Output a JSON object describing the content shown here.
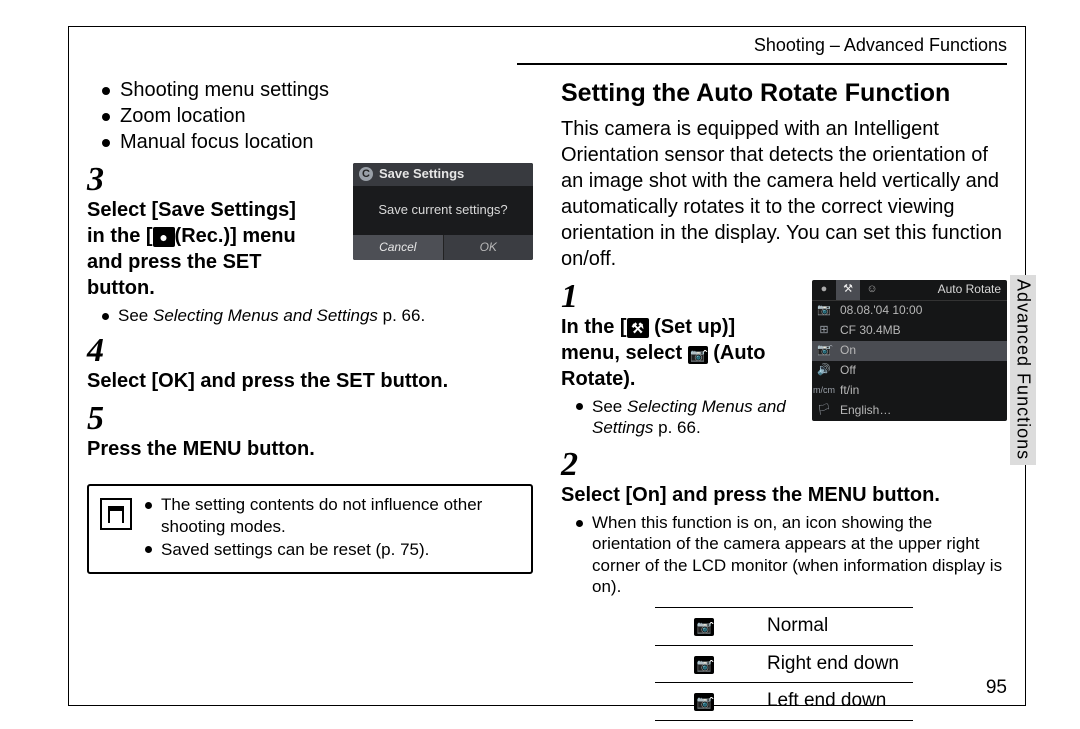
{
  "header": "Shooting – Advanced Functions",
  "left": {
    "bullets": [
      "Shooting menu settings",
      "Zoom location",
      "Manual focus location"
    ],
    "step3_a": "Select [Save Settings] in the [",
    "step3_b": "(Rec.)] menu and press the SET button.",
    "rec_icon": "●",
    "step3_sub_prefix": "See ",
    "step3_sub_em": "Selecting Menus and Settings",
    "step3_sub_suffix": " p. 66.",
    "step4": "Select [OK] and press the SET button.",
    "step5": "Press the MENU button.",
    "note1": "The setting contents do not influence other shooting modes.",
    "note2": "Saved settings can be reset (p. 75).",
    "lcd": {
      "title": "Save Settings",
      "prompt": "Save current settings?",
      "cancel": "Cancel",
      "ok": "OK"
    }
  },
  "right": {
    "heading": "Setting the Auto Rotate Function",
    "intro": "This camera is equipped with an Intelligent Orientation sensor that detects the orientation of an image shot with the camera held vertically and automatically rotates it to the correct viewing orientation in the display. You can set this function on/off.",
    "step1_a": "In the [",
    "step1_b": " (Set up)] menu, select ",
    "step1_c": " (Auto Rotate).",
    "tools_icon": "⚒",
    "cam_icon": "📷̂",
    "step1_sub_prefix": "See ",
    "step1_sub_em": "Selecting Menus and Settings",
    "step1_sub_suffix": " p. 66.",
    "step2": "Select [On] and press the MENU button.",
    "step2_sub": "When this function is on, an icon showing the orientation of the camera appears at the upper right corner of the LCD monitor (when information display is on).",
    "table": [
      {
        "icon": "📷̂",
        "label": "Normal"
      },
      {
        "icon": "📷̂",
        "label": "Right end down"
      },
      {
        "icon": "📷̂",
        "label": "Left end down"
      }
    ],
    "lcd": {
      "title": "Auto Rotate",
      "rows": [
        {
          "ic": "📷",
          "tx": "08.08.'04 10:00"
        },
        {
          "ic": "⊞",
          "tx": "CF 30.4MB"
        },
        {
          "ic": "📷̂",
          "tx": "On",
          "hl": true
        },
        {
          "ic": "🔊",
          "tx": "Off"
        },
        {
          "ic": "m/cm",
          "tx": "ft/in"
        },
        {
          "ic": "🏳",
          "tx": "English…"
        }
      ]
    }
  },
  "sidetab": "Advanced Functions",
  "pagenum": "95"
}
